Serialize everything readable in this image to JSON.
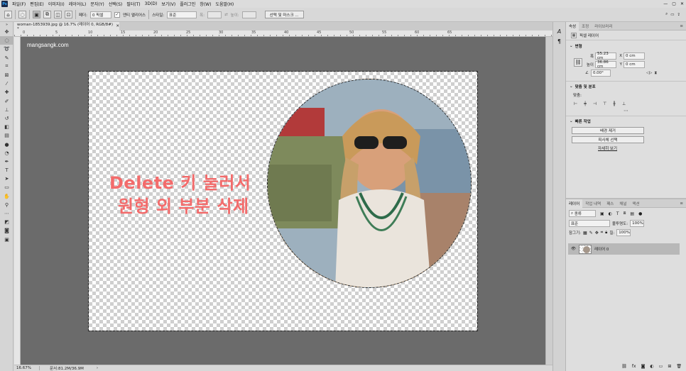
{
  "app": {
    "logo": "Ps",
    "menus": [
      "파일(F)",
      "편집(E)",
      "이미지(I)",
      "레이어(L)",
      "문자(Y)",
      "선택(S)",
      "필터(T)",
      "3D(D)",
      "보기(V)",
      "플러그인",
      "창(W)",
      "도움말(H)"
    ]
  },
  "options": {
    "feather_label": "페더:",
    "feather_value": "0 픽셀",
    "antialias_label": "앤티 앨리어스",
    "style_label": "스타일:",
    "style_value": "표준",
    "width_label": "폭:",
    "height_label": "높이:",
    "select_mask_button": "선택 및 마스크 ..."
  },
  "document": {
    "tab_title": "woman-1853939.jpg @ 16.7% (레이어 0, RGB/8#) *",
    "watermark": "mangsangk.com",
    "caption_line1": "Delete 키 눌러서",
    "caption_line2": "원형 외 부분 삭제",
    "ruler_ticks": [
      "0",
      "5",
      "10",
      "15",
      "20",
      "25",
      "30",
      "35",
      "40",
      "45",
      "50",
      "55",
      "60",
      "65"
    ]
  },
  "status": {
    "zoom": "16.67%",
    "doc_info": "문서:81.2M/36.9M"
  },
  "properties": {
    "tabs": [
      "속성",
      "조정",
      "라이브러리"
    ],
    "layer_kind": "픽셀 레이어",
    "transform_header": "변형",
    "w_label": "폭",
    "w_value": "55.23 cm",
    "h_label": "높이",
    "h_value": "36.86 cm",
    "x_label": "X",
    "x_value": "0 cm",
    "y_label": "Y",
    "y_value": "0 cm",
    "angle_value": "0.00°",
    "align_header": "맞춤 및 분포",
    "align_label": "맞춤:",
    "quick_actions_header": "빠른 작업",
    "remove_bg_button": "배경 제거",
    "select_subject_button": "피사체 선택",
    "learn_more_link": "자세히 보기"
  },
  "layers": {
    "tabs": [
      "레이어",
      "작업 내역",
      "패스",
      "채널",
      "액션"
    ],
    "filter_kind": "종류",
    "blend_mode": "표준",
    "opacity_label": "불투명도:",
    "opacity_value": "100%",
    "lock_label": "잠그기:",
    "fill_label": "칠:",
    "fill_value": "100%",
    "items": [
      {
        "name": "레이어 0"
      }
    ]
  }
}
